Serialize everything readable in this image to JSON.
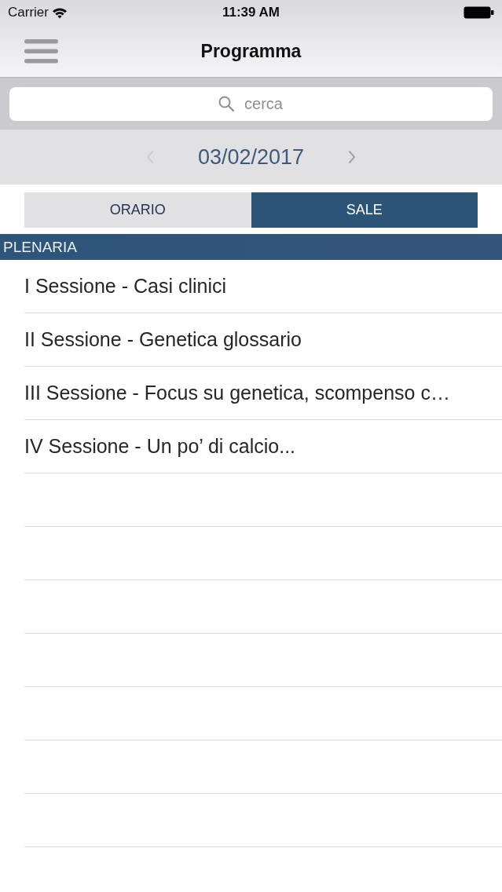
{
  "status_bar": {
    "carrier": "Carrier",
    "time": "11:39 AM"
  },
  "nav_bar": {
    "title": "Programma"
  },
  "search": {
    "placeholder": "cerca"
  },
  "date_nav": {
    "date": "03/02/2017",
    "prev": {
      "disabled": true
    },
    "next": {
      "disabled": false
    }
  },
  "tabs": [
    {
      "label": "ORARIO",
      "selected": false
    },
    {
      "label": "SALE",
      "selected": true
    }
  ],
  "sections": [
    {
      "title": "PLENARIA",
      "items": [
        {
          "title": "I Sessione - Casi clinici"
        },
        {
          "title": "II Sessione - Genetica glossario"
        },
        {
          "title": "III Sessione - Focus su genetica, scompenso c…"
        },
        {
          "title": "IV Sessione - Un po’ di calcio..."
        }
      ]
    }
  ]
}
